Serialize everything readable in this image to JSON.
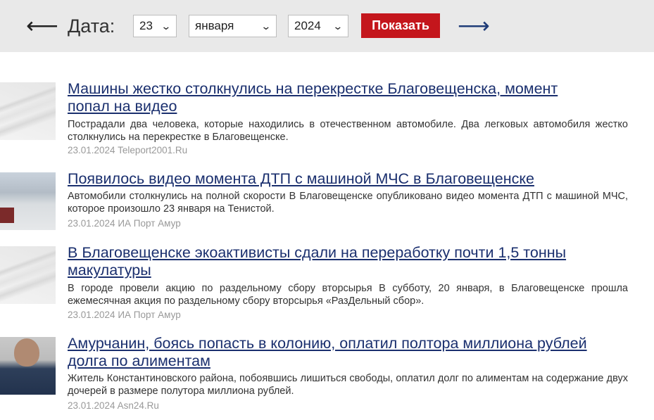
{
  "nav": {
    "prev_arrow": "⟵",
    "next_arrow": "⟶",
    "date_label": "Дата:",
    "day": "23",
    "month": "января",
    "year": "2024",
    "show_button": "Показать",
    "chevron": "⌄"
  },
  "news": [
    {
      "title_line1": "Машины жестко столкнулись на перекрестке Благовещенска, момент",
      "title_line2": "попал на видео",
      "snippet": "Пострадали два человека, которые находились в отечественном автомобиле.  Два легковых автомобиля жестко столкнулись на перекрестке в Благовещенске.",
      "date": "23.01.2024",
      "source": "Teleport2001.Ru"
    },
    {
      "title_line1": "Появилось видео момента ДТП с машиной МЧС в Благовещенске",
      "title_line2": "",
      "snippet": "Автомобили столкнулись на полной скорости В Благовещенске опубликовано видео момента ДТП с машиной МЧС, которое произошло 23 января на Тенистой.",
      "date": "23.01.2024",
      "source": "ИА Порт Амур"
    },
    {
      "title_line1": "В Благовещенске экоактивисты сдали на переработку почти 1,5 тонны",
      "title_line2": "макулатуры",
      "snippet": "В городе провели акцию по раздельному сбору вторсырья В субботу, 20 января, в Благовещенске прошла ежемесячная акция по раздельному сбору вторсырья «РазДельный сбор».",
      "date": "23.01.2024",
      "source": "ИА Порт Амур"
    },
    {
      "title_line1": "Амурчанин, боясь попасть в колонию, оплатил полтора миллиона рублей",
      "title_line2": "долга по алиментам",
      "snippet": "Житель Константиновского района, побоявшись лишиться свободы, оплатил долг по алиментам на содержание двух дочерей в размере полутора миллиона рублей.",
      "date": "23.01.2024",
      "source": "Asn24.Ru"
    }
  ]
}
